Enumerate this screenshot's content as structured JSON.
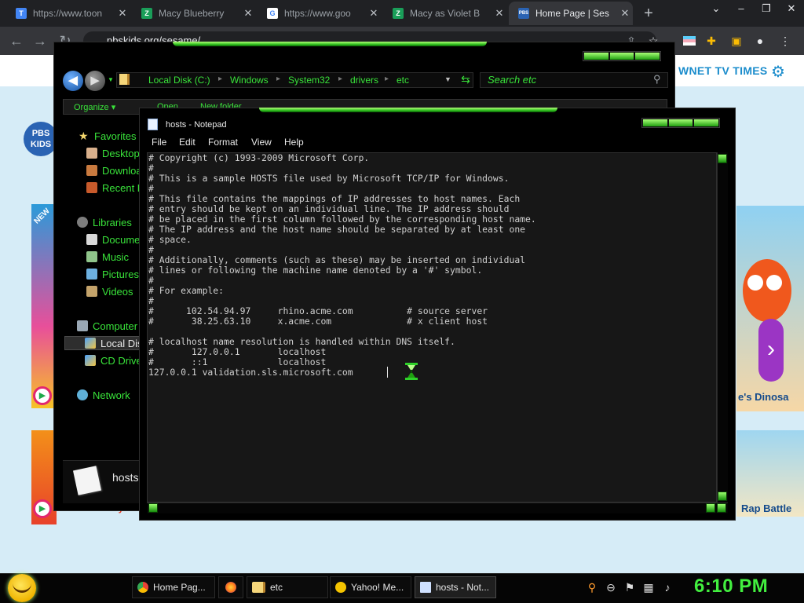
{
  "browser": {
    "tabs": [
      {
        "title": "https://www.toon",
        "favicon": "T",
        "color": "#4285f4"
      },
      {
        "title": "Macy Blueberry",
        "favicon": "Z",
        "color": "#1a9e59"
      },
      {
        "title": "https://www.goo",
        "favicon": "G",
        "color": "#ffffff"
      },
      {
        "title": "Macy as Violet B",
        "favicon": "Z",
        "color": "#1a9e59"
      },
      {
        "title": "Home Page | Ses",
        "favicon": "PBS",
        "color": "#2a63b3"
      }
    ],
    "new_tab_glyph": "+",
    "window_controls": [
      "⌄",
      "–",
      "❐",
      "✕"
    ],
    "address": "pbskids.org/sesame/",
    "nav": {
      "back": "←",
      "forward": "→",
      "reload": "↻"
    }
  },
  "site": {
    "nav_link": "WNET TV TIMES",
    "logo_text": "PBS KIDS",
    "new_badge": "NEW",
    "promo_right_1": "e's Dinosa",
    "promo_right_2": "Rap Battle",
    "promo_left_2": "Little Butterfly"
  },
  "explorer": {
    "breadcrumbs": [
      "Local Disk (C:)",
      "Windows",
      "System32",
      "drivers",
      "etc"
    ],
    "search_placeholder": "Search etc",
    "commands": {
      "organize": "Organize",
      "open": "Open",
      "new_folder": "New folder"
    },
    "nav_pane": [
      {
        "label": "Favorites",
        "icon": "star-icon"
      },
      {
        "label": "Desktop",
        "icon": "desktop-icon"
      },
      {
        "label": "Downloads",
        "icon": "downloads-icon"
      },
      {
        "label": "Recent Places",
        "icon": "recent-icon"
      },
      {
        "label": "Libraries",
        "icon": "libraries-icon"
      },
      {
        "label": "Documents",
        "icon": "documents-icon"
      },
      {
        "label": "Music",
        "icon": "music-icon"
      },
      {
        "label": "Pictures",
        "icon": "pictures-icon"
      },
      {
        "label": "Videos",
        "icon": "videos-icon"
      },
      {
        "label": "Computer",
        "icon": "computer-icon"
      },
      {
        "label": "Local Disk (C:)",
        "icon": "drive-icon"
      },
      {
        "label": "CD Drive",
        "icon": "cd-drive-icon"
      },
      {
        "label": "Network",
        "icon": "network-icon"
      }
    ],
    "details_name": "hosts"
  },
  "notepad": {
    "title": "hosts - Notepad",
    "menu": [
      "File",
      "Edit",
      "Format",
      "View",
      "Help"
    ],
    "lines": [
      "# Copyright (c) 1993-2009 Microsoft Corp.",
      "#",
      "# This is a sample HOSTS file used by Microsoft TCP/IP for Windows.",
      "#",
      "# This file contains the mappings of IP addresses to host names. Each",
      "# entry should be kept on an individual line. The IP address should",
      "# be placed in the first column followed by the corresponding host name.",
      "# The IP address and the host name should be separated by at least one",
      "# space.",
      "#",
      "# Additionally, comments (such as these) may be inserted on individual",
      "# lines or following the machine name denoted by a '#' symbol.",
      "#",
      "# For example:",
      "#",
      "#      102.54.94.97     rhino.acme.com          # source server",
      "#       38.25.63.10     x.acme.com              # x client host",
      "",
      "# localhost name resolution is handled within DNS itself.",
      "#\t127.0.0.1       localhost",
      "#\t::1             localhost",
      "127.0.0.1 validation.sls.microsoft.com"
    ]
  },
  "taskbar": {
    "tasks": [
      {
        "label": "Home Pag...",
        "icon": "chrome-icon",
        "color": "#4285f4"
      },
      {
        "label": "",
        "icon": "firefox-icon",
        "color": "#ff7a1a"
      },
      {
        "label": "etc",
        "icon": "folder-icon",
        "color": "#f5d67a"
      },
      {
        "label": "Yahoo! Me...",
        "icon": "messenger-icon",
        "color": "#f5c400"
      },
      {
        "label": "hosts - Not...",
        "icon": "notepad-icon",
        "color": "#cfe1ff"
      }
    ],
    "clock": "6:10 PM"
  },
  "colors": {
    "accent_green": "#39e33a",
    "clock_green": "#42ef3f"
  }
}
